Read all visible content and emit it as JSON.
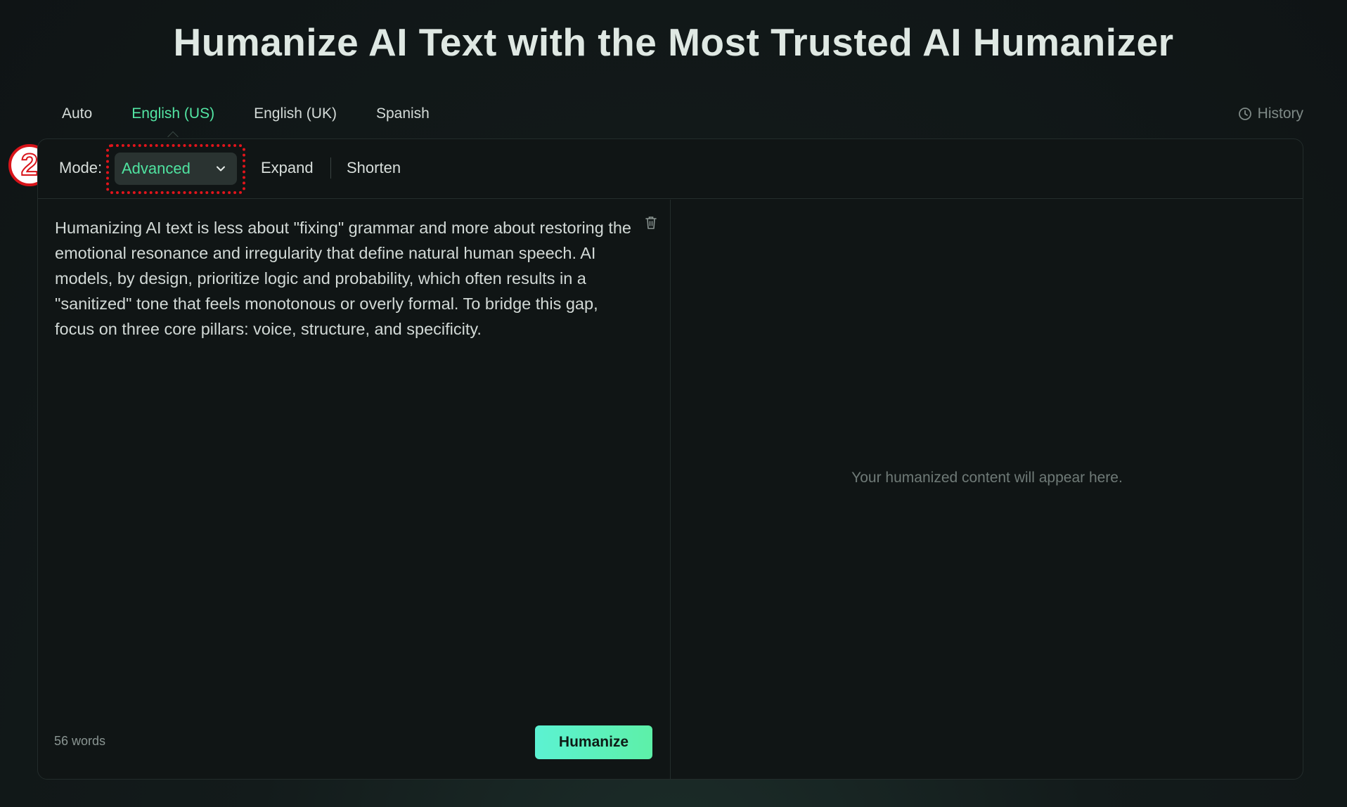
{
  "page": {
    "title": "Humanize AI Text with the Most Trusted AI Humanizer"
  },
  "language_tabs": [
    {
      "label": "Auto",
      "active": false
    },
    {
      "label": "English (US)",
      "active": true
    },
    {
      "label": "English (UK)",
      "active": false
    },
    {
      "label": "Spanish",
      "active": false
    }
  ],
  "history": {
    "label": "History",
    "icon": "clock-icon"
  },
  "toolbar": {
    "mode_label": "Mode:",
    "mode_selected": "Advanced",
    "mode_options": [
      "Expand",
      "Shorten"
    ]
  },
  "annotation": {
    "step": "2",
    "color": "#d8141a"
  },
  "editor": {
    "input_text": "Humanizing AI text is less about \"fixing\" grammar and more about restoring the emotional resonance and irregularity that define natural human speech. AI models, by design, prioritize logic and probability, which often results in a \"sanitized\" tone that feels monotonous or overly formal. To bridge this gap, focus on three core pillars: voice, structure, and specificity.",
    "word_count": "56 words",
    "humanize_label": "Humanize",
    "output_placeholder": "Your humanized content will appear here."
  },
  "colors": {
    "accent": "#4fe3a0",
    "button_gradient_start": "#5cf2d2",
    "button_gradient_end": "#5df0a8",
    "background": "#0f1415"
  }
}
